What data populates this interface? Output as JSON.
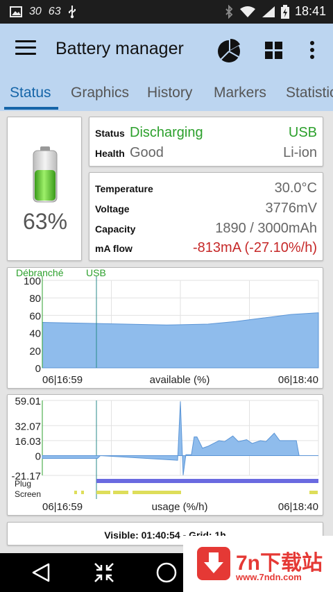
{
  "status_bar": {
    "left_numbers": [
      "30",
      "63"
    ],
    "time": "18:41",
    "icons": [
      "image-icon",
      "usb-icon",
      "bluetooth-icon",
      "wifi-icon",
      "signal-icon",
      "battery-charging-icon"
    ]
  },
  "app_bar": {
    "title": "Battery manager",
    "icons": [
      "menu-icon",
      "pie-chart-icon",
      "grid-icon",
      "more-vert-icon"
    ]
  },
  "tabs": [
    {
      "label": "Status",
      "active": true
    },
    {
      "label": "Graphics",
      "active": false
    },
    {
      "label": "History",
      "active": false
    },
    {
      "label": "Markers",
      "active": false
    },
    {
      "label": "Statistic",
      "active": false
    }
  ],
  "battery": {
    "percent_label": "63%",
    "level": 0.63
  },
  "status": {
    "status_label": "Status",
    "status_value": "Discharging",
    "plug_value": "USB",
    "health_label": "Health",
    "health_value": "Good",
    "tech_value": "Li-ion"
  },
  "info": {
    "temperature_label": "Temperature",
    "temperature_value": "30.0°C",
    "voltage_label": "Voltage",
    "voltage_value": "3776mV",
    "capacity_label": "Capacity",
    "capacity_value": "1890 / 3000mAh",
    "maflow_label": "mA flow",
    "maflow_value": "-813mA (-27.10%/h)"
  },
  "chart_data": [
    {
      "type": "area",
      "markers": [
        "Débranché",
        "USB"
      ],
      "yticks": [
        "100",
        "80",
        "60",
        "40",
        "20",
        "0"
      ],
      "ylim": [
        0,
        100
      ],
      "x_start_label": "06|16:59",
      "x_end_label": "06|18:40",
      "xlabel": "available (%)",
      "x": [
        0,
        0.15,
        0.3,
        0.45,
        0.6,
        0.7,
        0.8,
        0.9,
        1.0
      ],
      "values": [
        52,
        51,
        50,
        49,
        50,
        53,
        57,
        61,
        63
      ]
    },
    {
      "type": "area",
      "yticks": [
        "59.01",
        "32.07",
        "16.03",
        "0",
        "-21.17"
      ],
      "ylim": [
        -21.17,
        59.01
      ],
      "x_start_label": "06|16:59",
      "x_end_label": "06|18:40",
      "xlabel": "usage (%/h)",
      "row_labels": [
        "Plug",
        "Screen"
      ],
      "x": [
        0.0,
        0.2,
        0.21,
        0.49,
        0.5,
        0.51,
        0.52,
        0.54,
        0.55,
        0.56,
        0.57,
        0.58,
        0.6,
        0.62,
        0.64,
        0.66,
        0.69,
        0.71,
        0.74,
        0.76,
        0.79,
        0.81,
        0.84,
        0.86,
        0.87,
        0.92,
        0.93,
        0.95
      ],
      "values": [
        -3,
        -3,
        0,
        -5,
        58,
        -21,
        1,
        1,
        20,
        20,
        14,
        8,
        10,
        13,
        16,
        15,
        21,
        15,
        17,
        13,
        16,
        15,
        24,
        16,
        16,
        16,
        0,
        0
      ]
    }
  ],
  "footer": {
    "text": "Visible: 01:40:54 - Grid: 1h"
  },
  "nav": {
    "icons": [
      "back-icon",
      "compress-icon",
      "home-icon"
    ]
  },
  "watermark": {
    "name": "7n下载站",
    "url": "www.7ndn.com"
  }
}
